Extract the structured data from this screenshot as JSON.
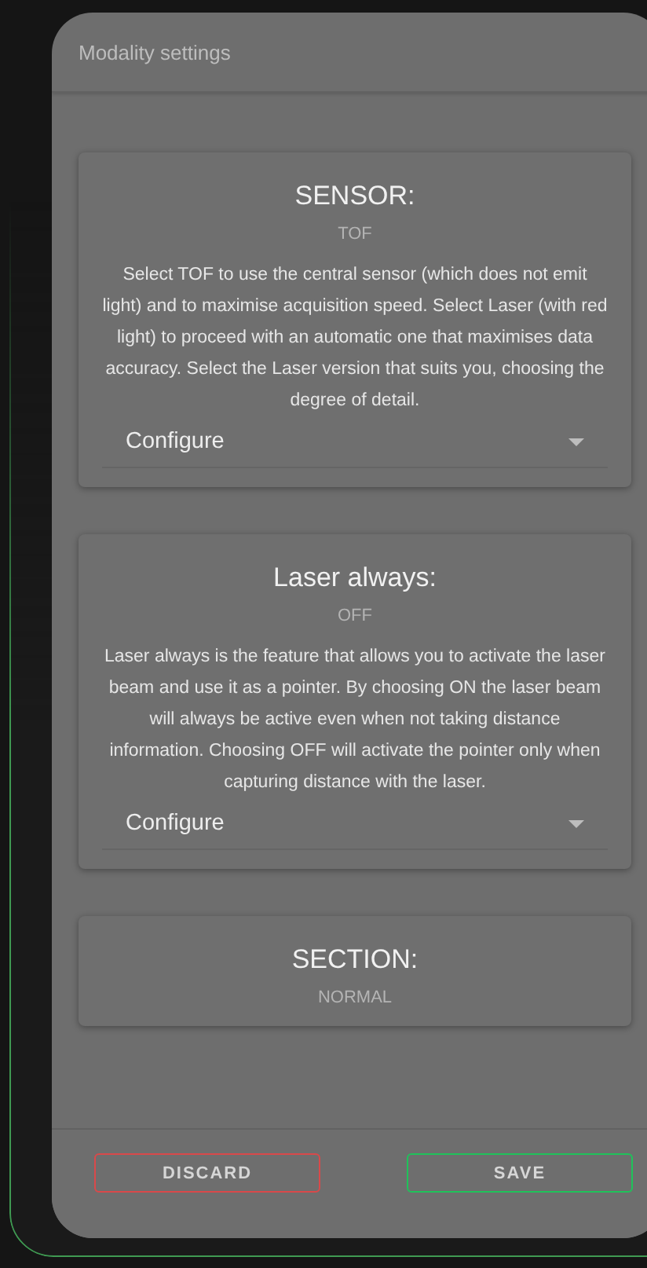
{
  "dialog": {
    "title": "Modality settings"
  },
  "sections": [
    {
      "title": "SENSOR:",
      "value": "TOF",
      "description": "Select TOF to use the central sensor (which does not emit light) and to maximise acquisition speed. Select Laser (with red light) to proceed with an automatic one that maximises data accuracy. Select the Laser version that suits you, choosing the degree of detail.",
      "select": "Configure"
    },
    {
      "title": "Laser always:",
      "value": "OFF",
      "description": "Laser always is the feature that allows you to activate the laser beam and use it as a pointer. By choosing ON the laser beam will always be active even when not taking distance information. Choosing OFF will activate the pointer only when capturing distance with the laser.",
      "select": "Configure"
    },
    {
      "title": "SECTION:",
      "value": "NORMAL"
    }
  ],
  "buttons": [
    {
      "label": "DISCARD",
      "color": "#d9494a"
    },
    {
      "label": "SAVE",
      "color": "#1fc25a"
    }
  ]
}
